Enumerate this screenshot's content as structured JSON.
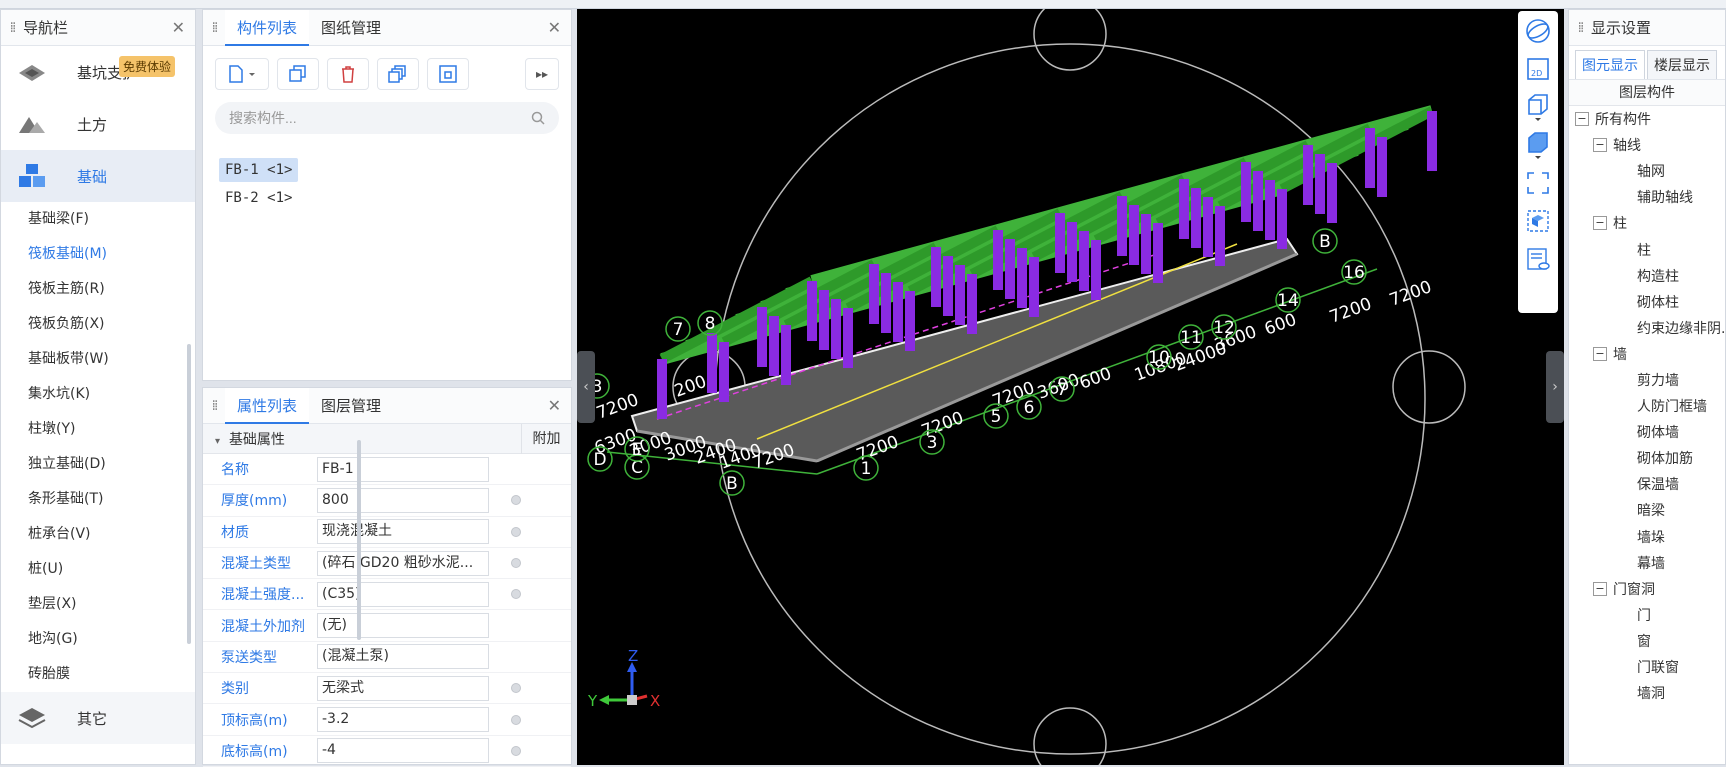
{
  "nav": {
    "title": "导航栏",
    "categories_top": [
      {
        "label": "基坑支护",
        "icon": "pit-support-icon"
      },
      {
        "label": "土方",
        "icon": "earthwork-icon"
      },
      {
        "label": "基础",
        "icon": "foundation-icon"
      }
    ],
    "badge": "免费体验",
    "items": [
      "基础梁(F)",
      "筏板基础(M)",
      "筏板主筋(R)",
      "筏板负筋(X)",
      "基础板带(W)",
      "集水坑(K)",
      "柱墩(Y)",
      "独立基础(D)",
      "条形基础(T)",
      "桩承台(V)",
      "桩(U)",
      "垫层(X)",
      "地沟(G)",
      "砖胎膜"
    ],
    "selected_item": "筏板基础(M)",
    "category_bottom": "其它"
  },
  "component_list": {
    "tabs": [
      "构件列表",
      "图纸管理"
    ],
    "search_placeholder": "搜索构件...",
    "items": [
      "FB-1 <1>",
      "FB-2 <1>"
    ],
    "selected": "FB-1 <1>"
  },
  "property_list": {
    "tabs": [
      "属性列表",
      "图层管理"
    ],
    "group_label": "基础属性",
    "extra_col": "附加",
    "rows": [
      {
        "name": "名称",
        "value": "FB-1",
        "dot": false
      },
      {
        "name": "厚度(mm)",
        "value": "800",
        "dot": true
      },
      {
        "name": "材质",
        "value": "现浇混凝土",
        "dot": true
      },
      {
        "name": "混凝土类型",
        "value": "(碎石 GD20 粗砂水泥...",
        "dot": true
      },
      {
        "name": "混凝土强度...",
        "value": "(C35)",
        "dot": true
      },
      {
        "name": "混凝土外加剂",
        "value": "(无)",
        "dot": false
      },
      {
        "name": "泵送类型",
        "value": "(混凝土泵)",
        "dot": false
      },
      {
        "name": "类别",
        "value": "无梁式",
        "dot": true
      },
      {
        "name": "顶标高(m)",
        "value": "-3.2",
        "dot": true
      },
      {
        "name": "底标高(m)",
        "value": "-4",
        "dot": true
      }
    ]
  },
  "viewport": {
    "dim_labels": [
      "7200",
      "7200",
      "7200",
      "3600",
      "600",
      "10800",
      "24000",
      "3600",
      "600",
      "7200",
      "7200",
      "7200",
      "6300",
      "3000",
      "3000",
      "2400",
      "1400",
      "200",
      "7200"
    ],
    "axis_numbers": [
      "1",
      "3",
      "5",
      "6",
      "7",
      "8",
      "10",
      "11",
      "12",
      "14",
      "16",
      "7",
      "3"
    ],
    "axis_letters": [
      "B",
      "C",
      "D",
      "E",
      "B"
    ],
    "triad": {
      "x": "X",
      "y": "Y",
      "z": "Z"
    }
  },
  "display_settings": {
    "title": "显示设置",
    "tabs": [
      "图元显示",
      "楼层显示"
    ],
    "column_header": "图层构件",
    "tree": [
      {
        "label": "所有构件",
        "level": 0,
        "toggle": "−"
      },
      {
        "label": "轴线",
        "level": 1,
        "toggle": "−"
      },
      {
        "label": "轴网",
        "level": 2
      },
      {
        "label": "辅助轴线",
        "level": 2
      },
      {
        "label": "柱",
        "level": 1,
        "toggle": "−"
      },
      {
        "label": "柱",
        "level": 2
      },
      {
        "label": "构造柱",
        "level": 2
      },
      {
        "label": "砌体柱",
        "level": 2
      },
      {
        "label": "约束边缘非阴...",
        "level": 2
      },
      {
        "label": "墙",
        "level": 1,
        "toggle": "−"
      },
      {
        "label": "剪力墙",
        "level": 2
      },
      {
        "label": "人防门框墙",
        "level": 2
      },
      {
        "label": "砌体墙",
        "level": 2
      },
      {
        "label": "砌体加筋",
        "level": 2
      },
      {
        "label": "保温墙",
        "level": 2
      },
      {
        "label": "暗梁",
        "level": 2
      },
      {
        "label": "墙垛",
        "level": 2
      },
      {
        "label": "幕墙",
        "level": 2
      },
      {
        "label": "门窗洞",
        "level": 1,
        "toggle": "−"
      },
      {
        "label": "门",
        "level": 2
      },
      {
        "label": "窗",
        "level": 2
      },
      {
        "label": "门联窗",
        "level": 2
      },
      {
        "label": "墙洞",
        "level": 2
      }
    ]
  },
  "colors": {
    "accent": "#2f7ae5",
    "beam": "#3fb23a",
    "column": "#8a2be2",
    "slab": "#d9d9d9"
  }
}
